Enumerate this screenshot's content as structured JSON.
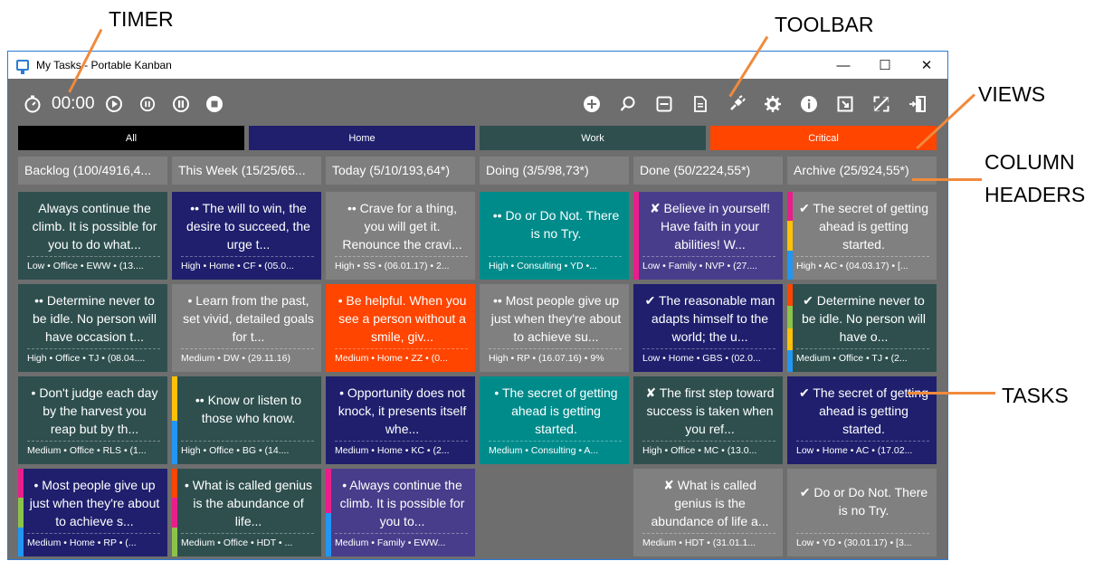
{
  "callouts": {
    "timer": "TIMER",
    "toolbar": "TOOLBAR",
    "views": "VIEWS",
    "column_headers_1": "COLUMN",
    "column_headers_2": "HEADERS",
    "tasks": "TASKS"
  },
  "window": {
    "title": "My Tasks - Portable Kanban",
    "controls": [
      "—",
      "☐",
      "✕"
    ]
  },
  "timer": {
    "value": "00:00"
  },
  "views": [
    {
      "label": "All",
      "color": "#000000"
    },
    {
      "label": "Home",
      "color": "#1f1f6e"
    },
    {
      "label": "Work",
      "color": "#2f4f4f"
    },
    {
      "label": "Critical",
      "color": "#ff4500"
    }
  ],
  "columns": [
    {
      "header": "Backlog  (100/4916,4...",
      "cards": [
        {
          "text": "Always continue the climb. It is possible for you to do what...",
          "meta": "Low • Office • EWW • (13....",
          "bg": "#2f4f4f",
          "stripe": []
        },
        {
          "text": "•• Determine never to be idle. No person will have occasion t...",
          "meta": "High • Office • TJ • (08.04....",
          "bg": "#2f4f4f",
          "stripe": []
        },
        {
          "text": "• Don't judge each day by the harvest you reap but by th...",
          "meta": "Medium • Office • RLS • (1...",
          "bg": "#2f4f4f",
          "stripe": []
        },
        {
          "text": "• Most people give up just when they're about to achieve s...",
          "meta": "Medium • Home • RP • (...",
          "bg": "#1f1f6e",
          "stripe": [
            "#e91e8c",
            "#8bc34a",
            "#2196f3"
          ]
        }
      ]
    },
    {
      "header": "This Week  (15/25/65...",
      "cards": [
        {
          "text": "•• The will to win, the desire to succeed, the urge t...",
          "meta": "High • Home • CF • (05.0...",
          "bg": "#1f1f6e",
          "stripe": []
        },
        {
          "text": "• Learn from the past, set vivid, detailed goals for t...",
          "meta": "Medium • DW • (29.11.16)",
          "bg": "#808080",
          "stripe": []
        },
        {
          "text": "•• Know or listen to those who know.",
          "meta": "High • Office • BG • (14....",
          "bg": "#2f4f4f",
          "stripe": [
            "#ffc107",
            "#2196f3"
          ],
          "short": true
        },
        {
          "text": "• What is called genius is the abundance of life...",
          "meta": "Medium • Office • HDT • ...",
          "bg": "#2f4f4f",
          "stripe": [
            "#ff4500",
            "#e91e8c",
            "#8bc34a"
          ]
        }
      ]
    },
    {
      "header": "Today (5/10/193,64*)",
      "cards": [
        {
          "text": "•• Crave for a thing, you will get it. Renounce the cravi...",
          "meta": "High • SS • (06.01.17) • 2...",
          "bg": "#808080",
          "stripe": []
        },
        {
          "text": "• Be helpful. When you see a person without a smile, giv...",
          "meta": "Medium • Home • ZZ • (0...",
          "bg": "#ff4500",
          "stripe": []
        },
        {
          "text": "• Opportunity does not knock, it presents itself whe...",
          "meta": "Medium • Home • KC • (2...",
          "bg": "#1f1f6e",
          "stripe": []
        },
        {
          "text": "• Always continue the climb. It is possible for you to...",
          "meta": "Medium • Family • EWW...",
          "bg": "#483d8b",
          "stripe": [
            "#e91e8c",
            "#2196f3"
          ]
        }
      ]
    },
    {
      "header": "Doing (3/5/98,73*)",
      "cards": [
        {
          "text": "•• Do or Do Not. There is no Try.",
          "meta": "High • Consulting • YD •...",
          "bg": "#008b8b",
          "stripe": [],
          "short": true
        },
        {
          "text": "•• Most people give up just when they're about to achieve su...",
          "meta": "High • RP • (16.07.16) • 9%",
          "bg": "#808080",
          "stripe": []
        },
        {
          "text": "• The secret of getting ahead is getting started.",
          "meta": "Medium • Consulting • A...",
          "bg": "#008b8b",
          "stripe": []
        }
      ]
    },
    {
      "header": "Done (50/2224,55*)",
      "cards": [
        {
          "text": "✘ Believe in yourself! Have faith in your abilities! W...",
          "meta": "Low • Family • NVP • (27....",
          "bg": "#483d8b",
          "stripe": [
            "#e91e8c"
          ]
        },
        {
          "text": "✔ The reasonable man adapts himself to the world; the u...",
          "meta": "Low • Home • GBS • (02.0...",
          "bg": "#1f1f6e",
          "stripe": []
        },
        {
          "text": "✘ The first step toward success is taken when you ref...",
          "meta": "High • Office • MC • (13.0...",
          "bg": "#2f4f4f",
          "stripe": []
        },
        {
          "text": "✘ What is called genius is the abundance of life a...",
          "meta": "Medium • HDT • (31.01.1...",
          "bg": "#808080",
          "stripe": []
        }
      ]
    },
    {
      "header": "Archive (25/924,55*)",
      "cards": [
        {
          "text": "✔ The secret of getting ahead is getting started.",
          "meta": "High • AC • (04.03.17) • [...",
          "bg": "#808080",
          "stripe": [
            "#e91e8c",
            "#ffc107",
            "#2196f3"
          ]
        },
        {
          "text": "✔ Determine never to be idle. No person will have o...",
          "meta": "Medium • Office • TJ • (2...",
          "bg": "#2f4f4f",
          "stripe": [
            "#ff4500",
            "#8bc34a",
            "#ffc107",
            "#2196f3"
          ]
        },
        {
          "text": "✔ The secret of getting ahead is getting started.",
          "meta": "Low • Home • AC • (17.02...",
          "bg": "#1f1f6e",
          "stripe": []
        },
        {
          "text": "✔ Do or Do Not. There is no Try.",
          "meta": "Low • YD • (30.01.17) • [3...",
          "bg": "#808080",
          "stripe": [],
          "short": true
        }
      ]
    }
  ]
}
